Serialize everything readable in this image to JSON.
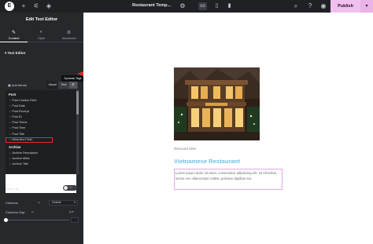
{
  "topbar": {
    "title": "Restaurant Temp...",
    "publish_label": "Publish",
    "icons": [
      "elementor-logo",
      "plus-icon",
      "sliders-icon",
      "layers-icon",
      "gear-icon",
      "desktop-icon",
      "tablet-icon",
      "mobile-icon",
      "search-icon",
      "help-icon",
      "eye-icon",
      "chevron-down-icon"
    ]
  },
  "panel": {
    "title": "Edit Text Editor",
    "tabs": [
      {
        "label": "Content",
        "icon": "pencil-icon"
      },
      {
        "label": "Style",
        "icon": "half-circle-icon"
      },
      {
        "label": "Advanced",
        "icon": "gear-icon"
      }
    ],
    "section_title": "Text Editor",
    "add_media_label": "Add Media",
    "editor_tabs": [
      "Visual",
      "Text"
    ],
    "tooltip": "Dynamic Tags",
    "tag_groups": [
      {
        "name": "Post",
        "items": [
          "Post Custom Field",
          "Post Date",
          "Post Excerpt",
          "Post ID",
          "Post Terms",
          "Post Time",
          "Post Title",
          "Meta Box Field"
        ]
      },
      {
        "name": "Archive",
        "items": [
          "Archive Description",
          "Archive Meta",
          "Archive Title"
        ]
      }
    ],
    "selected_tag": "Meta Box Field",
    "drop_cap_label": "Drop Cap",
    "drop_cap_state": "No",
    "columns_label": "Columns",
    "columns_value": "Default",
    "columns_gap_label": "Columns Gap",
    "columns_gap_unit": "px"
  },
  "canvas": {
    "discount": "Discount 30%",
    "heading": "Vietnamese Restaurant",
    "body": "Lorem ipsum dolor sit amet, consectetur adipiscing elit. Ut elit tellus, luctus nec ullamcorper mattis, pulvinar dapibus leo."
  },
  "colors": {
    "accent": "#6ec1e4",
    "publish": "#f0c0ef",
    "highlight": "#e02a2a"
  }
}
